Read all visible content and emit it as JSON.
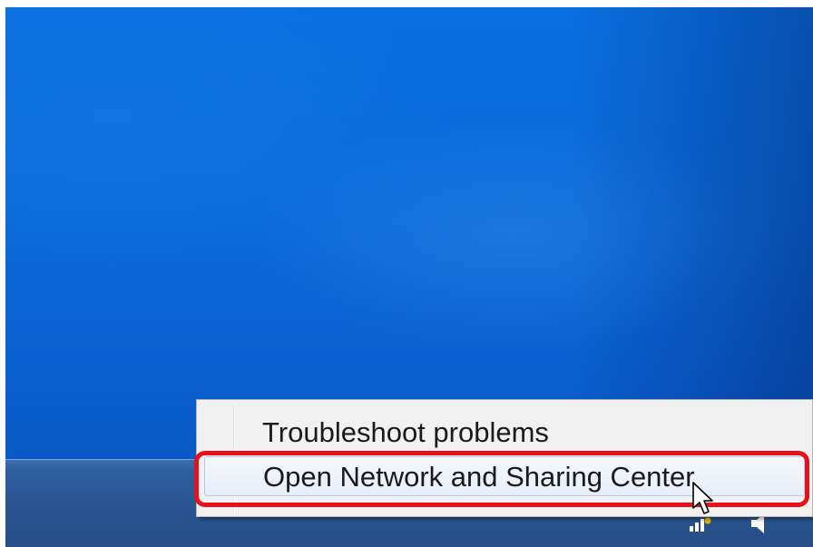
{
  "context_menu": {
    "items": [
      {
        "label": "Troubleshoot problems",
        "highlighted": false
      },
      {
        "label": "Open Network and Sharing Center",
        "highlighted": true
      }
    ]
  },
  "annotation": {
    "highlight_color": "#e8101a",
    "target": "Open Network and Sharing Center"
  },
  "desktop": {
    "background_color": "#0a6ad9",
    "taskbar_color": "#2a5590"
  },
  "tray": {
    "icons": [
      "action-center-flag-icon",
      "network-icon",
      "speaker-icon"
    ]
  }
}
